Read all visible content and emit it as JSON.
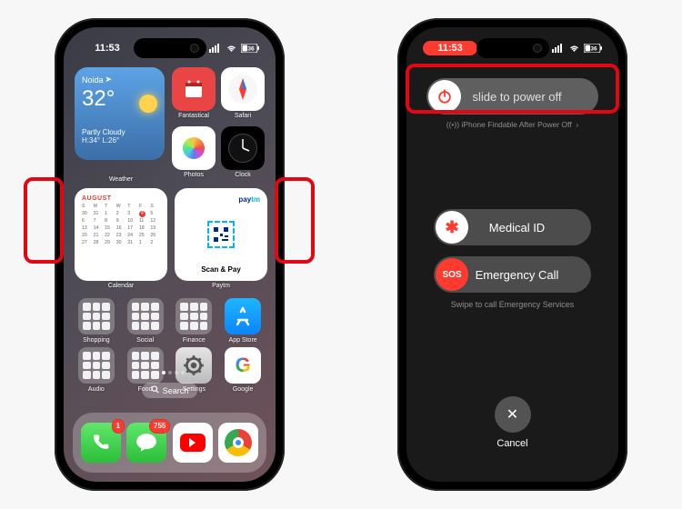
{
  "statusbar": {
    "time_home": "11:53",
    "time_power": "11:53",
    "battery": "36",
    "signal": "••••",
    "wifi": "on"
  },
  "weather": {
    "location": "Noida",
    "temp": "32°",
    "condition": "Partly Cloudy",
    "hilo": "H:34° L:26°",
    "label": "Weather"
  },
  "mini": {
    "fantastical": "Fantastical",
    "safari": "Safari",
    "photos": "Photos",
    "clock": "Clock"
  },
  "calendar": {
    "month": "AUGUST",
    "label": "Calendar",
    "dow": [
      "S",
      "M",
      "T",
      "W",
      "T",
      "F",
      "S"
    ],
    "current_day": "4",
    "days": [
      "30",
      "31",
      "1",
      "2",
      "3",
      "4",
      "5",
      "6",
      "7",
      "8",
      "9",
      "10",
      "11",
      "12",
      "13",
      "14",
      "15",
      "16",
      "17",
      "18",
      "19",
      "20",
      "21",
      "22",
      "23",
      "24",
      "25",
      "26",
      "27",
      "28",
      "29",
      "30",
      "31",
      "1",
      "2"
    ]
  },
  "paytm": {
    "brand_pay": "pay",
    "brand_tm": "tm",
    "scan": "Scan & Pay",
    "label": "Paytm"
  },
  "apps_row1": {
    "shopping": "Shopping",
    "social": "Social",
    "finance": "Finance",
    "appstore": "App Store"
  },
  "apps_row2": {
    "audio": "Audio",
    "food": "Food",
    "settings": "Settings",
    "google": "Google"
  },
  "search": {
    "label": "Search"
  },
  "dock": {
    "phone_badge": "1",
    "messages_badge": "755"
  },
  "power": {
    "slide": "slide to power off",
    "findable": "iPhone Findable After Power Off",
    "medical": "Medical ID",
    "medical_icon": "✱",
    "sos": "SOS",
    "emergency": "Emergency Call",
    "swipe_note": "Swipe to call Emergency Services",
    "cancel": "Cancel",
    "cancel_icon": "✕"
  }
}
